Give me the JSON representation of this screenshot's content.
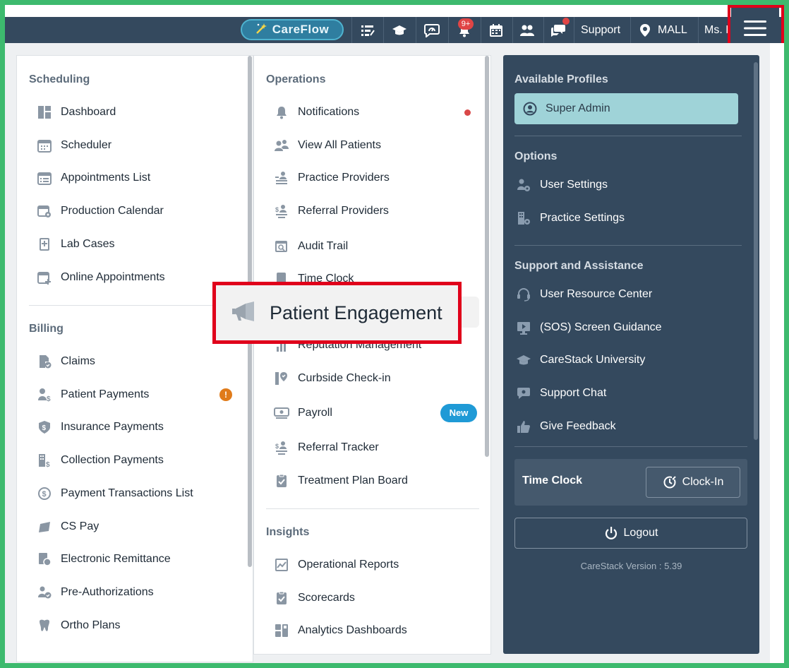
{
  "topbar": {
    "careflow_label": "CareFlow",
    "notification_count": "9+",
    "support_label": "Support",
    "location_label": "MALL",
    "user_label": "Ms. L"
  },
  "scheduling": {
    "title": "Scheduling",
    "items": [
      {
        "label": "Dashboard",
        "icon": "dashboard-icon"
      },
      {
        "label": "Scheduler",
        "icon": "calendar-icon"
      },
      {
        "label": "Appointments List",
        "icon": "calendar-list-icon"
      },
      {
        "label": "Production Calendar",
        "icon": "calendar-gear-icon"
      },
      {
        "label": "Lab Cases",
        "icon": "lab-case-icon"
      },
      {
        "label": "Online Appointments",
        "icon": "calendar-plus-icon"
      }
    ]
  },
  "billing": {
    "title": "Billing",
    "items": [
      {
        "label": "Claims",
        "icon": "claims-icon"
      },
      {
        "label": "Patient Payments",
        "icon": "patient-payment-icon"
      },
      {
        "label": "Insurance Payments",
        "icon": "shield-dollar-icon"
      },
      {
        "label": "Collection Payments",
        "icon": "building-dollar-icon"
      },
      {
        "label": "Payment Transactions List",
        "icon": "dollar-cycle-icon"
      },
      {
        "label": "CS Pay",
        "icon": "cs-pay-icon"
      },
      {
        "label": "Electronic Remittance",
        "icon": "remittance-icon"
      },
      {
        "label": "Pre-Authorizations",
        "icon": "user-check-icon"
      },
      {
        "label": "Ortho Plans",
        "icon": "tooth-dollar-icon"
      }
    ]
  },
  "operations": {
    "title": "Operations",
    "items": [
      {
        "label": "Notifications",
        "icon": "bell-icon"
      },
      {
        "label": "View All Patients",
        "icon": "users-icon"
      },
      {
        "label": "Practice Providers",
        "icon": "providers-icon"
      },
      {
        "label": "Referral Providers",
        "icon": "referral-icon"
      },
      {
        "label": "Audit Trail",
        "icon": "audit-icon"
      },
      {
        "label": "Time Clock",
        "icon": "time-clock-icon"
      },
      {
        "label": "Reputation Management",
        "icon": "chart-icon"
      },
      {
        "label": "Curbside Check-in",
        "icon": "curbside-icon"
      },
      {
        "label": "Payroll",
        "icon": "payroll-icon"
      },
      {
        "label": "Referral Tracker",
        "icon": "referral-tracker-icon"
      },
      {
        "label": "Treatment Plan Board",
        "icon": "clipboard-check-icon"
      }
    ],
    "new_badge": "New"
  },
  "insights": {
    "title": "Insights",
    "items": [
      {
        "label": "Operational Reports",
        "icon": "report-icon"
      },
      {
        "label": "Scorecards",
        "icon": "scorecard-icon"
      },
      {
        "label": "Analytics Dashboards",
        "icon": "analytics-icon"
      }
    ]
  },
  "callout": {
    "label": "Patient Engagement",
    "icon": "megaphone-icon"
  },
  "profiles": {
    "title": "Available Profiles",
    "selected": "Super Admin"
  },
  "options": {
    "title": "Options",
    "items": [
      {
        "label": "User Settings",
        "icon": "user-gear-icon"
      },
      {
        "label": "Practice Settings",
        "icon": "building-gear-icon"
      }
    ]
  },
  "support": {
    "title": "Support and Assistance",
    "items": [
      {
        "label": "User Resource Center",
        "icon": "headset-icon"
      },
      {
        "label": "(SOS) Screen Guidance",
        "icon": "screen-play-icon"
      },
      {
        "label": "CareStack University",
        "icon": "graduation-cap-icon"
      },
      {
        "label": "Support Chat",
        "icon": "chat-gear-icon"
      },
      {
        "label": "Give Feedback",
        "icon": "thumbs-up-icon"
      }
    ]
  },
  "time_clock": {
    "label": "Time Clock",
    "button": "Clock-In"
  },
  "logout_label": "Logout",
  "version": "CareStack Version : 5.39",
  "colors": {
    "accent": "#34495e",
    "highlight_border": "#e0001b",
    "new_badge": "#1f9ad6",
    "warning": "#e07b1a",
    "profile_bg": "#9fd3d8"
  }
}
